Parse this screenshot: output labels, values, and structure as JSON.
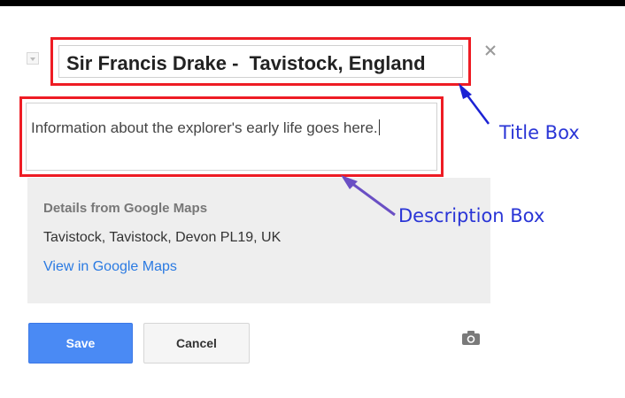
{
  "marker": {
    "title": "Sir Francis Drake -  Tavistock, England",
    "description": "Information about the explorer's early life goes here."
  },
  "details": {
    "heading": "Details from Google Maps",
    "address": "Tavistock, Tavistock, Devon PL19, UK",
    "link_label": "View in Google Maps"
  },
  "buttons": {
    "save_label": "Save",
    "cancel_label": "Cancel"
  },
  "annotations": {
    "title_box": "Title Box",
    "description_box": "Description Box"
  },
  "icons": {
    "close": "close-icon",
    "camera": "camera-icon",
    "dropdown": "chevron-down-icon"
  },
  "colors": {
    "highlight_box": "#ee1c24",
    "annotation": "#2a35d6",
    "save_button": "#4a8af4",
    "link": "#2a7ae2",
    "details_background": "#eeeeee"
  }
}
